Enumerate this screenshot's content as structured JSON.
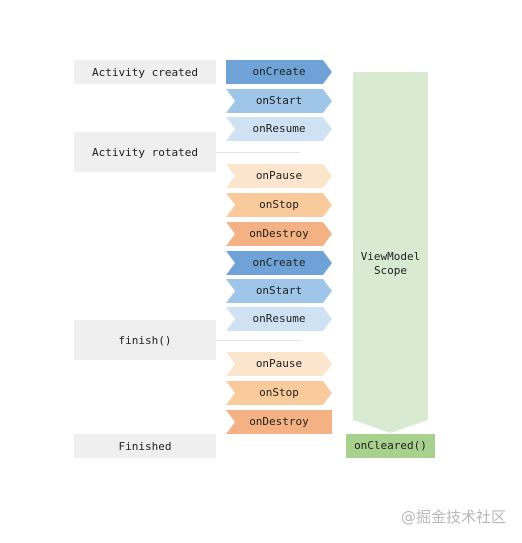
{
  "events": [
    {
      "label": "Activity created"
    },
    {
      "label": "Activity rotated"
    },
    {
      "label": "finish()"
    },
    {
      "label": "Finished"
    }
  ],
  "lifecycle_steps": [
    {
      "label": "onCreate",
      "color": "#6fa3d8",
      "shape": "flat-left"
    },
    {
      "label": "onStart",
      "color": "#9fc5e8",
      "shape": "chevron"
    },
    {
      "label": "onResume",
      "color": "#cfe2f3",
      "shape": "chevron"
    },
    {
      "label": "onPause",
      "color": "#fce5cd",
      "shape": "chevron"
    },
    {
      "label": "onStop",
      "color": "#f9cb9c",
      "shape": "chevron"
    },
    {
      "label": "onDestroy",
      "color": "#f4b183",
      "shape": "chevron"
    },
    {
      "label": "onCreate",
      "color": "#6fa3d8",
      "shape": "chevron"
    },
    {
      "label": "onStart",
      "color": "#9fc5e8",
      "shape": "chevron"
    },
    {
      "label": "onResume",
      "color": "#cfe2f3",
      "shape": "chevron"
    },
    {
      "label": "onPause",
      "color": "#fce5cd",
      "shape": "chevron"
    },
    {
      "label": "onStop",
      "color": "#f9cb9c",
      "shape": "chevron"
    },
    {
      "label": "onDestroy",
      "color": "#f4b183",
      "shape": "flat-right"
    }
  ],
  "scope": {
    "label_line1": "ViewModel",
    "label_line2": "Scope",
    "color": "#d9ead3"
  },
  "cleared": {
    "label": "onCleared()",
    "color": "#a9d18e"
  },
  "watermark": "@掘金技术社区"
}
